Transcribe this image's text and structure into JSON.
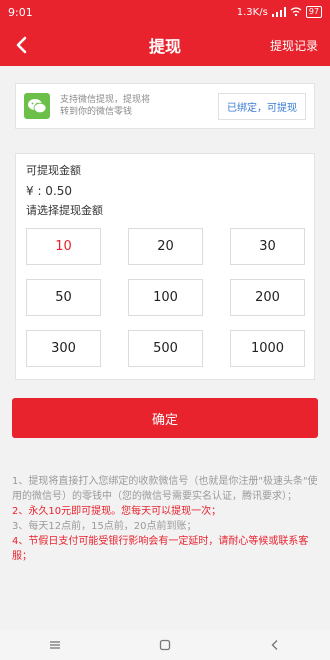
{
  "status": {
    "time": "9:01",
    "speed": "1.3K/s",
    "battery": "97"
  },
  "nav": {
    "title": "提现",
    "record": "提现记录"
  },
  "wechat": {
    "desc_line1": "支持微信提现，提现将",
    "desc_line2": "转到你的微信零钱",
    "bound_label": "已绑定，可提现"
  },
  "amount": {
    "label": "可提现金额",
    "balance": "¥ : 0.50",
    "choose": "请选择提现金额",
    "options": [
      "10",
      "20",
      "30",
      "50",
      "100",
      "200",
      "300",
      "500",
      "1000"
    ]
  },
  "confirm_label": "确定",
  "notes": {
    "n1": "1、提现将直接打入您绑定的收款微信号（也就是你注册\"极速头条\"使用的微信号）的零钱中（您的微信号需要实名认证，腾讯要求）；",
    "n2": "2、永久10元即可提现。您每天可以提现一次；",
    "n3": "3、每天12点前，15点前，20点前到账；",
    "n4": "4、节假日支付可能受银行影响会有一定延时，请耐心等候或联系客服；"
  },
  "colors": {
    "brand": "#e8232e",
    "wechat": "#6cc04a",
    "link": "#3a7bd5"
  }
}
